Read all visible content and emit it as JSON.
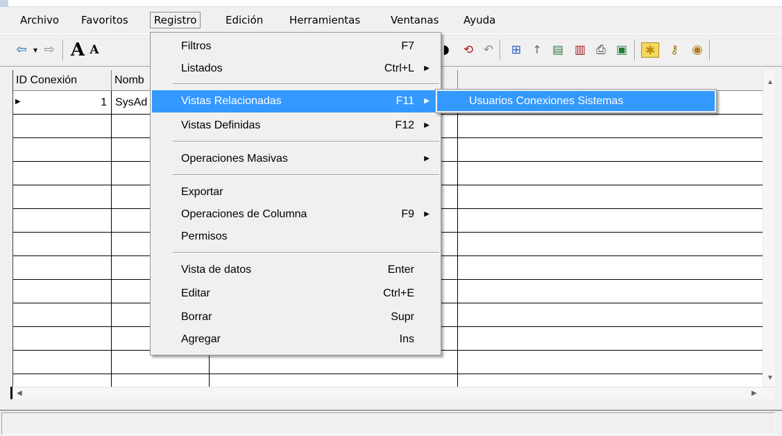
{
  "menubar": {
    "items": [
      {
        "label": "Archivo"
      },
      {
        "label": "Favoritos"
      },
      {
        "label": "Registro"
      },
      {
        "label": "Edición"
      },
      {
        "label": "Herramientas"
      },
      {
        "label": "Ventanas"
      },
      {
        "label": "Ayuda"
      }
    ]
  },
  "toolbar": {
    "icons": [
      "back-arrow-icon",
      "dropdown-dot-icon",
      "forward-arrow-icon",
      "font-increase-icon",
      "font-decrease-icon",
      "refresh-icon",
      "undo-icon",
      "tree-icon",
      "up-arrow-icon",
      "chart-icon",
      "table-icon",
      "print-icon",
      "excel-icon",
      "folder-icon",
      "search-key-icon",
      "globe-icon"
    ],
    "font_large": "A",
    "font_small": "A"
  },
  "grid": {
    "columns": [
      {
        "label": "ID Conexión"
      },
      {
        "label": "Nomb"
      }
    ],
    "rows": [
      {
        "id": "1",
        "nombre": "SysAd"
      }
    ]
  },
  "registro_menu": {
    "items": [
      {
        "label": "Filtros",
        "shortcut": "F7"
      },
      {
        "label": "Listados",
        "shortcut": "Ctrl+L"
      },
      {
        "label": "Vistas Relacionadas",
        "shortcut": "F11"
      },
      {
        "label": "Vistas Definidas",
        "shortcut": "F12"
      },
      {
        "label": "Operaciones Masivas",
        "shortcut": ""
      },
      {
        "label": "Exportar",
        "shortcut": ""
      },
      {
        "label": "Operaciones de Columna",
        "shortcut": "F9"
      },
      {
        "label": "Permisos",
        "shortcut": ""
      },
      {
        "label": "Vista de datos",
        "shortcut": "Enter"
      },
      {
        "label": "Editar",
        "shortcut": "Ctrl+E"
      },
      {
        "label": "Borrar",
        "shortcut": "Supr"
      },
      {
        "label": "Agregar",
        "shortcut": "Ins"
      }
    ]
  },
  "submenu": {
    "items": [
      {
        "label": "Usuarios Conexiones Sistemas"
      }
    ]
  },
  "colors": {
    "highlight": "#3399ff",
    "menu_bg": "#f0f0f0"
  }
}
